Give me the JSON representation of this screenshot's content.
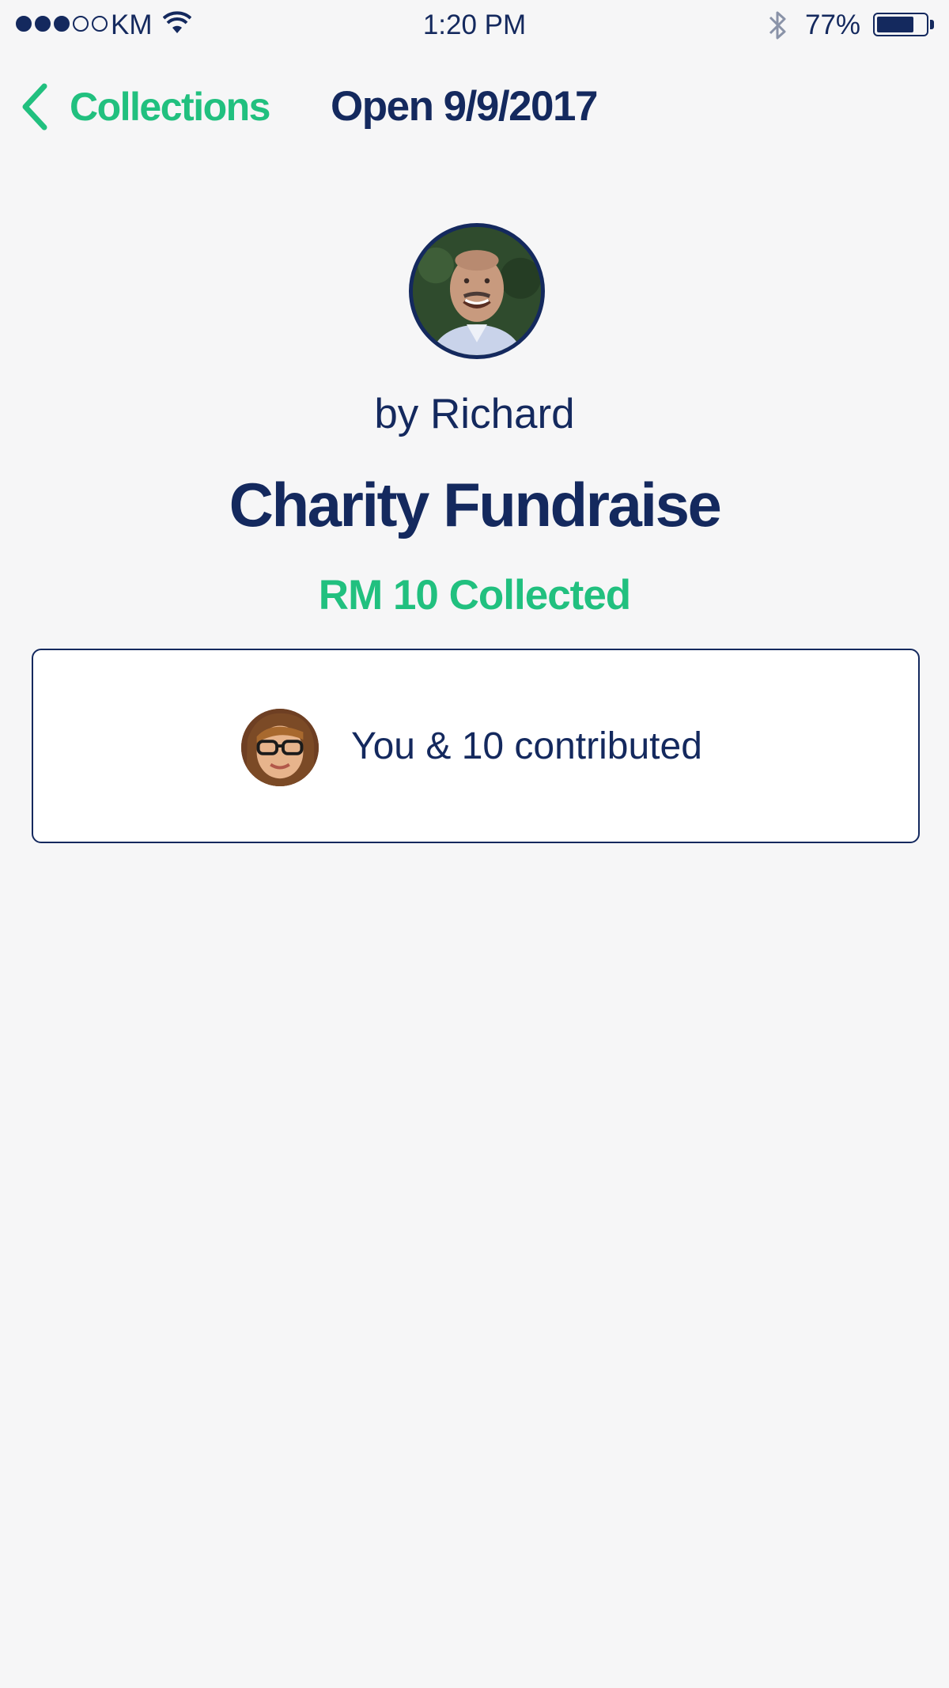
{
  "status_bar": {
    "signal_dots": [
      true,
      true,
      true,
      false,
      false
    ],
    "carrier": "KM",
    "time": "1:20 PM",
    "battery_percent": "77%",
    "battery_level": 0.77,
    "icons": [
      "wifi-icon",
      "bluetooth-icon",
      "battery-icon"
    ]
  },
  "nav": {
    "back_label": "Collections",
    "title": "Open 9/9/2017"
  },
  "collection": {
    "owner_line": "by Richard",
    "title": "Charity Fundraise",
    "collected": "RM 10 Collected"
  },
  "contributors": {
    "summary": "You & 10 contributed"
  },
  "colors": {
    "navy": "#14295e",
    "green": "#21c07f",
    "background": "#f6f6f7",
    "card": "#ffffff"
  }
}
